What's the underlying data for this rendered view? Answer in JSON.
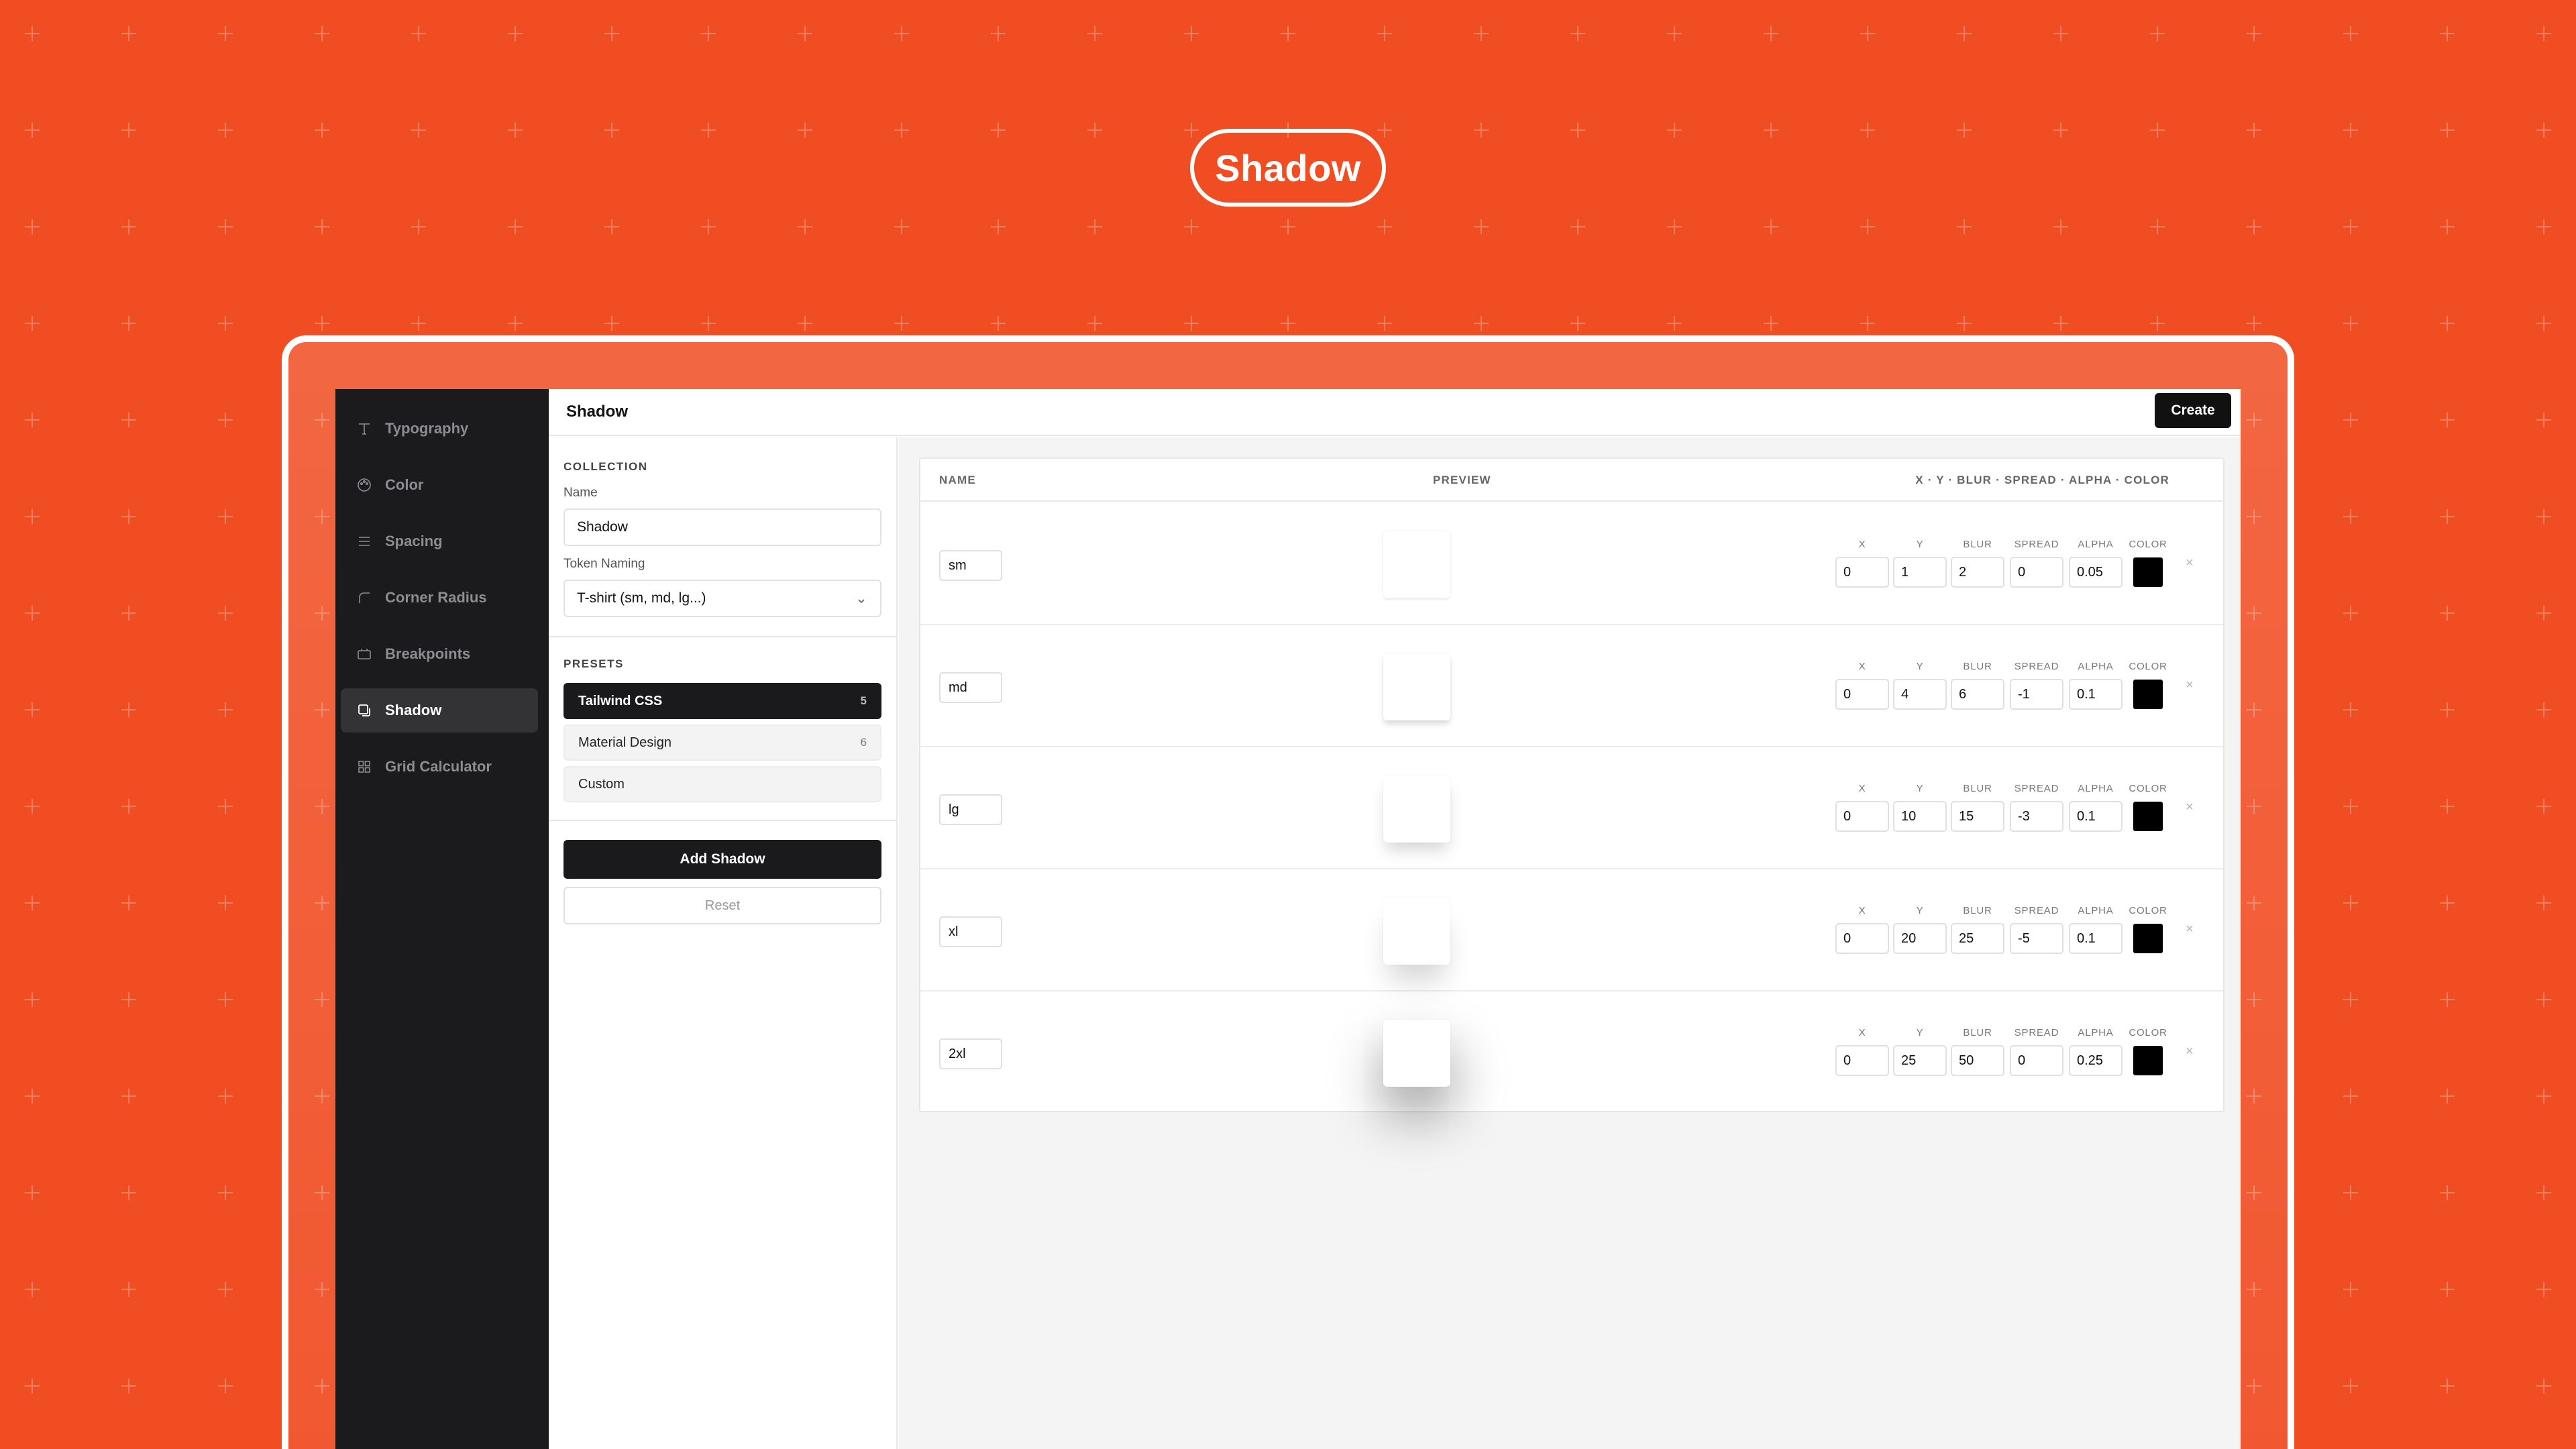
{
  "hero": {
    "title": "Shadow"
  },
  "sidebar": {
    "items": [
      {
        "label": "Typography",
        "icon": "type-icon",
        "active": false
      },
      {
        "label": "Color",
        "icon": "palette-icon",
        "active": false
      },
      {
        "label": "Spacing",
        "icon": "lines-icon",
        "active": false
      },
      {
        "label": "Corner Radius",
        "icon": "corner-icon",
        "active": false
      },
      {
        "label": "Breakpoints",
        "icon": "device-icon",
        "active": false
      },
      {
        "label": "Shadow",
        "icon": "shadow-icon",
        "active": true
      },
      {
        "label": "Grid Calculator",
        "icon": "grid-icon",
        "active": false
      }
    ]
  },
  "topbar": {
    "title": "Shadow",
    "create_label": "Create"
  },
  "panel": {
    "collection_label": "COLLECTION",
    "name_label": "Name",
    "name_value": "Shadow",
    "token_naming_label": "Token Naming",
    "token_naming_value": "T-shirt (sm, md, lg...)",
    "presets_label": "PRESETS",
    "presets": [
      {
        "label": "Tailwind CSS",
        "count": "5",
        "active": true
      },
      {
        "label": "Material Design",
        "count": "6",
        "active": false
      },
      {
        "label": "Custom",
        "count": "",
        "active": false
      }
    ],
    "add_label": "Add Shadow",
    "reset_label": "Reset"
  },
  "table": {
    "col_name": "NAME",
    "col_preview": "PREVIEW",
    "col_params": "X · Y · BLUR · SPREAD · ALPHA · COLOR",
    "param_labels": {
      "x": "X",
      "y": "Y",
      "blur": "BLUR",
      "spread": "SPREAD",
      "alpha": "ALPHA",
      "color": "COLOR"
    },
    "remove_symbol": "×",
    "rows": [
      {
        "name": "sm",
        "x": "0",
        "y": "1",
        "blur": "2",
        "spread": "0",
        "alpha": "0.05",
        "color": "#000000"
      },
      {
        "name": "md",
        "x": "0",
        "y": "4",
        "blur": "6",
        "spread": "-1",
        "alpha": "0.1",
        "color": "#000000"
      },
      {
        "name": "lg",
        "x": "0",
        "y": "10",
        "blur": "15",
        "spread": "-3",
        "alpha": "0.1",
        "color": "#000000"
      },
      {
        "name": "xl",
        "x": "0",
        "y": "20",
        "blur": "25",
        "spread": "-5",
        "alpha": "0.1",
        "color": "#000000"
      },
      {
        "name": "2xl",
        "x": "0",
        "y": "25",
        "blur": "50",
        "spread": "0",
        "alpha": "0.25",
        "color": "#000000"
      }
    ]
  },
  "colors": {
    "background": "#f04d23",
    "sidebar": "#1b1b1d",
    "accent_dark": "#111112"
  }
}
